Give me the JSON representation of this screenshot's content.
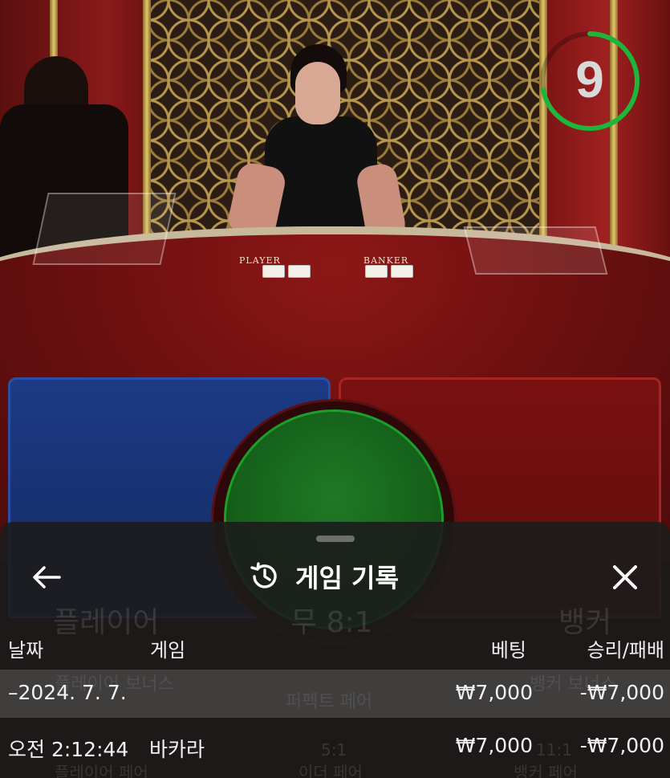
{
  "timer": {
    "seconds_left": "9",
    "ring_color": "#1fb43a",
    "ring_fraction": 0.72
  },
  "table": {
    "player_label": "PLAYER",
    "banker_label": "BANKER"
  },
  "background_bets": {
    "player": "플레이어",
    "tie": "무 8:1",
    "banker": "뱅커",
    "player_bonus": "플레이어 보너스",
    "perfect_pair": "퍼펙트 페어",
    "banker_bonus": "뱅커 보너스",
    "either_pair_odds": "5:1",
    "either_pair": "이더 페어",
    "player_pair": "플레이어 페어",
    "banker_pair_odds": "11:1",
    "banker_pair": "뱅커 페어"
  },
  "sheet": {
    "title": "게임 기록",
    "back_icon": "arrow-left-icon",
    "history_icon": "history-icon",
    "close_icon": "close-icon",
    "columns": {
      "date": "날짜",
      "game": "게임",
      "bet": "베팅",
      "result": "승리/패배"
    },
    "date_row": {
      "date": "–2024. 7. 7.",
      "bet": "₩7,000",
      "result": "-₩7,000"
    },
    "rows": [
      {
        "time": "오전 2:12:44",
        "game": "바카라",
        "bet": "₩7,000",
        "result": "-₩7,000"
      }
    ]
  },
  "colors": {
    "player": "#1d3a86",
    "banker": "#7a1111",
    "tie": "#1f7a24",
    "sheet_bg": "#1c1c1c"
  }
}
